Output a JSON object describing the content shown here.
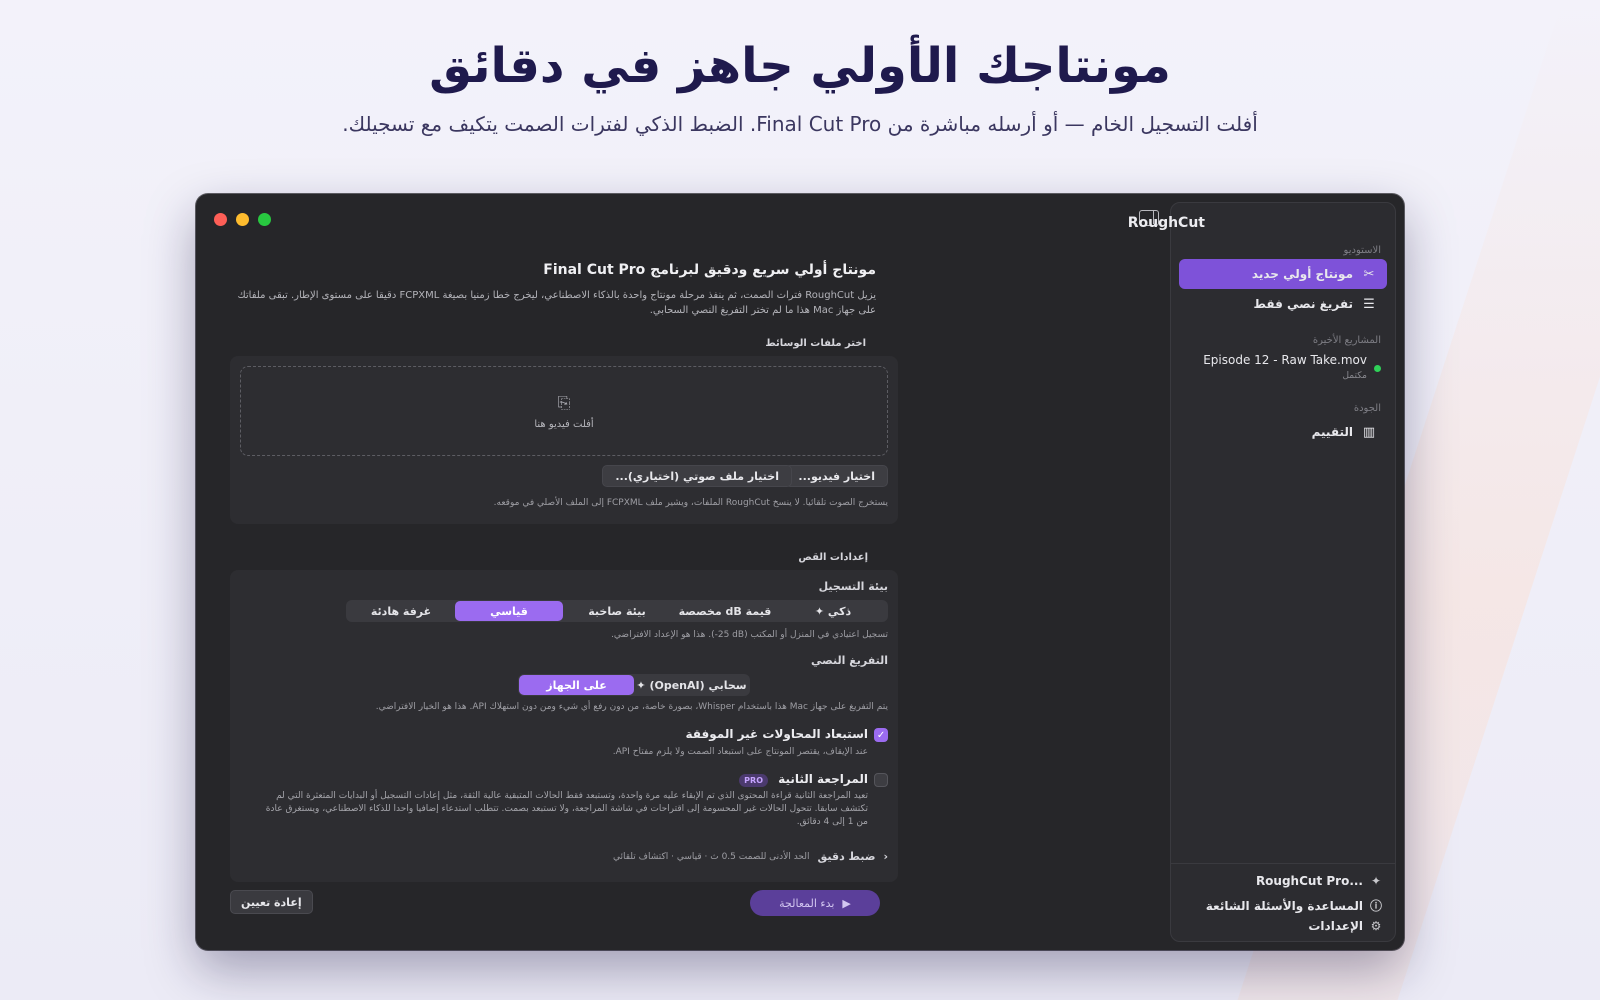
{
  "hero": {
    "headline": "مونتاجك الأولي جاهز في دقائق",
    "subline": "أفلت التسجيل الخام — أو أرسله مباشرة من Final Cut Pro. الضبط الذكي لفترات الصمت يتكيف مع تسجيلك."
  },
  "sidebar": {
    "app_title": "RoughCut",
    "studio_heading": "الاستوديو",
    "items": [
      {
        "label": "مونتاج أولي جديد",
        "icon": "scissors-icon",
        "active": true
      },
      {
        "label": "تفريغ نصي فقط",
        "icon": "transcript-icon",
        "active": false
      }
    ],
    "recent_heading": "المشاريع الأخيرة",
    "recent": [
      {
        "name": "Episode 12 - Raw Take.mov",
        "status": "مكتمل"
      }
    ],
    "quality_heading": "الجودة",
    "quality_item": {
      "label": "التقييم",
      "icon": "bar-chart-icon"
    },
    "footer": [
      {
        "label": "RoughCut Pro...",
        "icon": "sparkle-icon"
      },
      {
        "label": "المساعدة والأسئلة الشائعة",
        "icon": "help-icon"
      },
      {
        "label": "الإعدادات",
        "icon": "gear-icon"
      }
    ]
  },
  "main": {
    "title": "مونتاج أولي سريع ودقيق لبرنامج Final Cut Pro",
    "description": "يزيل RoughCut فترات الصمت، ثم ينفذ مرحلة مونتاج واحدة بالذكاء الاصطناعي، ليخرج خطا زمنيا بصيغة FCPXML دقيقا على مستوى الإطار. تبقى ملفاتك على جهاز Mac هذا ما لم تختر التفريغ النصي السحابي.",
    "media_label": "اختر ملفات الوسائط",
    "drop_text": "أفلت فيديو هنا",
    "choose_video": "اختيار فيديو...",
    "choose_audio": "اختيار ملف صوتي (اختياري)...",
    "media_note": "يستخرج الصوت تلقائيا. لا ينسخ RoughCut الملفات، ويشير ملف FCPXML إلى الملف الأصلي في موقعه.",
    "cut_settings_label": "إعدادات القص",
    "env_label": "بيئة التسجيل",
    "env_options": [
      "ذكي ✦",
      "قيمة dB مخصصة",
      "بيئة صاخبة",
      "قياسي",
      "غرفة هادئة"
    ],
    "env_selected": "قياسي",
    "env_note": "تسجيل اعتيادي في المنزل أو المكتب (‎-25 dB). هذا هو الإعداد الافتراضي.",
    "transcription_label": "التفريغ النصي",
    "transcription_options": [
      "سحابي (OpenAI) ✦",
      "على الجهاز"
    ],
    "transcription_selected": "على الجهاز",
    "transcription_note": "يتم التفريغ على جهاز Mac هذا باستخدام Whisper، بصورة خاصة، من دون رفع أي شيء ومن دون استهلاك API. هذا هو الخيار الافتراضي.",
    "exclude_label": "استبعاد المحاولات غير الموفقة",
    "exclude_checked": true,
    "exclude_note": "عند الإيقاف، يقتصر المونتاج على استبعاد الصمت ولا يلزم مفتاح API.",
    "second_review_label": "المراجعة الثانية",
    "second_review_checked": false,
    "pro_badge": "PRO",
    "second_review_note": "تعيد المراجعة الثانية قراءة المحتوى الذي تم الإبقاء عليه مرة واحدة، وتستبعد فقط الحالات المتبقية عالية الثقة، مثل إعادات التسجيل أو البدايات المتعثرة التي لم تكتشف سابقا. تتحول الحالات غير المحسومة إلى اقتراحات في شاشة المراجعة، ولا تستبعد بصمت. تتطلب استدعاء إضافيا واحدا للذكاء الاصطناعي، ويستغرق عادة من 1 إلى 4 دقائق.",
    "fine_tune_label": "ضبط دقيق",
    "fine_tune_summary": "الحد الأدنى للصمت 0.5 ث · قياسي · اكتشاف تلقائي",
    "reset_label": "إعادة تعيين",
    "start_label": "بدء المعالجة"
  },
  "colors": {
    "accent": "#9b6bf0",
    "sidebar_active": "#7e52d9",
    "window_bg": "#262629"
  }
}
